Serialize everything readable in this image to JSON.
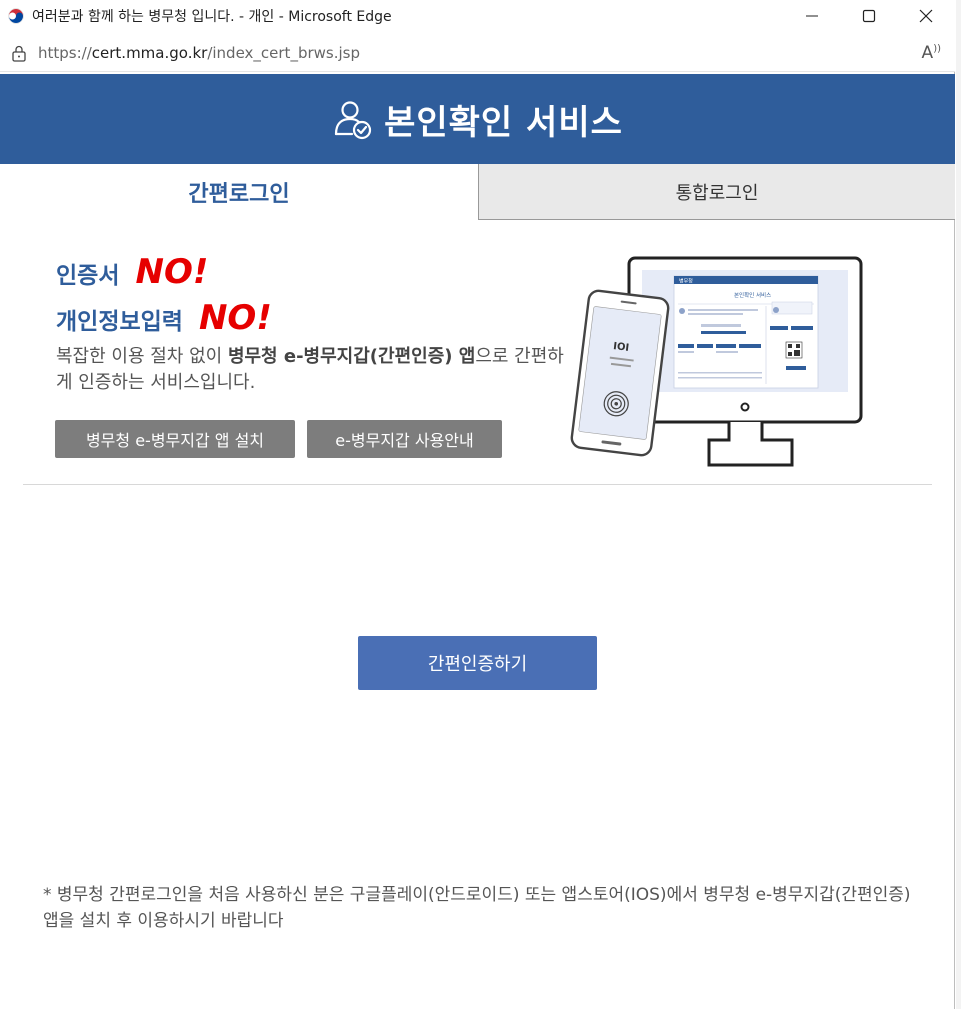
{
  "browser": {
    "window_title": "여러분과 함께 하는 병무청 입니다. - 개인 - Microsoft Edge",
    "url_prefix": "https://",
    "url_host": "cert.mma.go.kr",
    "url_path": "/index_cert_brws.jsp",
    "read_aloud_label": "A"
  },
  "header": {
    "title": "본인확인 서비스"
  },
  "tabs": [
    {
      "label": "간편로그인",
      "active": true
    },
    {
      "label": "통합로그인",
      "active": false
    }
  ],
  "intro": {
    "line1_lead": "인증서",
    "line1_no": "NO!",
    "line2_lead": "개인정보입력",
    "line2_no": "NO!",
    "desc_part1": "복잡한 이용 절차 없이 ",
    "desc_bold": "병무청 e-병무지갑(간편인증) 앱",
    "desc_part2": "으로 간편하게 인증하는 서비스입니다."
  },
  "buttons": {
    "install_app": "병무청 e-병무지갑 앱 설치",
    "guide": "e-병무지갑 사용안내",
    "authenticate": "간편인증하기"
  },
  "illustration": {
    "monitor_header": "병무청",
    "monitor_title": "본인확인 서비스",
    "phone_logo": "IOI"
  },
  "notice": "* 병무청 간편로그인을 처음 사용하신 분은 구글플레이(안드로이드) 또는 앱스토어(IOS)에서 병무청 e-병무지갑(간편인증) 앱을 설치 후 이용하시기 바랍니다",
  "colors": {
    "brand_blue": "#2f5d9b",
    "no_red": "#e60000",
    "button_gray": "#7d7d7d",
    "primary_button": "#4a6fb5"
  }
}
